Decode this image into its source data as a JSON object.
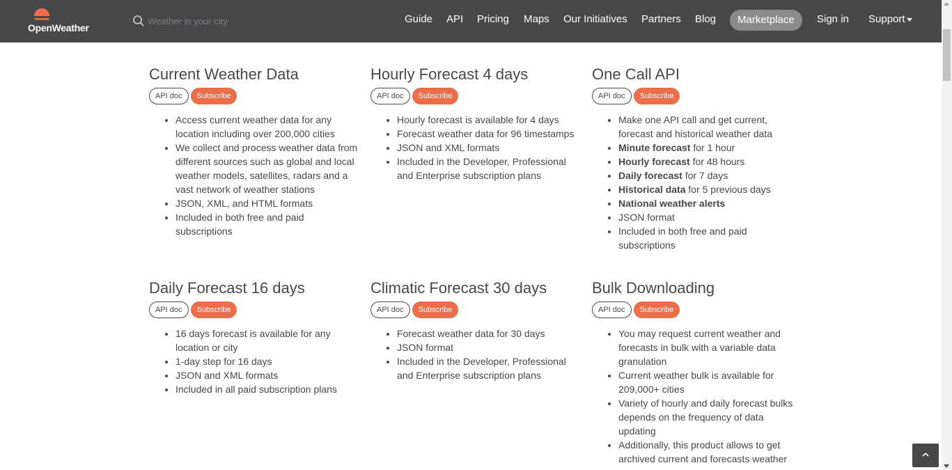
{
  "header": {
    "logo_text": "OpenWeather",
    "logo_icon": "sun-logo-icon",
    "search": {
      "placeholder": "Weather in your city",
      "icon": "search-icon"
    },
    "nav": [
      {
        "label": "Guide"
      },
      {
        "label": "API"
      },
      {
        "label": "Pricing"
      },
      {
        "label": "Maps"
      },
      {
        "label": "Our Initiatives"
      },
      {
        "label": "Partners"
      },
      {
        "label": "Blog"
      },
      {
        "label": "Marketplace",
        "highlighted": true
      },
      {
        "label": "Sign in"
      },
      {
        "label": "Support",
        "has_dropdown": true
      }
    ]
  },
  "colors": {
    "header_bg": "#48484a",
    "accent": "#eb6e4b",
    "pill_bg": "#8b8b8d",
    "text": "#48484a"
  },
  "products": [
    {
      "title": "Current Weather Data",
      "api_doc": "API doc",
      "subscribe": "Subscribe",
      "features": [
        {
          "text": "Access current weather data for any location including over 200,000 cities"
        },
        {
          "text": "We collect and process weather data from different sources such as global and local weather models, satellites, radars and a vast network of weather stations"
        },
        {
          "text": "JSON, XML, and HTML formats"
        },
        {
          "text": "Included in both free and paid subscriptions"
        }
      ]
    },
    {
      "title": "Hourly Forecast 4 days",
      "api_doc": "API doc",
      "subscribe": "Subscribe",
      "features": [
        {
          "text": "Hourly forecast is available for 4 days"
        },
        {
          "text": "Forecast weather data for 96 timestamps"
        },
        {
          "text": "JSON and XML formats"
        },
        {
          "text": "Included in the Developer, Professional and Enterprise subscription plans"
        }
      ]
    },
    {
      "title": "One Call API",
      "api_doc": "API doc",
      "subscribe": "Subscribe",
      "features": [
        {
          "text": "Make one API call and get current, forecast and historical weather data"
        },
        {
          "bold": "Minute forecast",
          "text": " for 1 hour"
        },
        {
          "bold": "Hourly forecast",
          "text": " for 48 hours"
        },
        {
          "bold": "Daily forecast",
          "text": " for 7 days"
        },
        {
          "bold": "Historical data",
          "text": " for 5 previous days"
        },
        {
          "bold": "National weather alerts",
          "text": ""
        },
        {
          "text": "JSON format"
        },
        {
          "text": "Included in both free and paid subscriptions"
        }
      ]
    },
    {
      "title": "Daily Forecast 16 days",
      "api_doc": "API doc",
      "subscribe": "Subscribe",
      "features": [
        {
          "text": "16 days forecast is available for any location or city"
        },
        {
          "text": "1-day step for 16 days"
        },
        {
          "text": "JSON and XML formats"
        },
        {
          "text": "Included in all paid subscription plans"
        }
      ]
    },
    {
      "title": "Climatic Forecast 30 days",
      "api_doc": "API doc",
      "subscribe": "Subscribe",
      "features": [
        {
          "text": "Forecast weather data for 30 days"
        },
        {
          "text": "JSON format"
        },
        {
          "text": "Included in the Developer, Professional and Enterprise subscription plans"
        }
      ]
    },
    {
      "title": "Bulk Downloading",
      "api_doc": "API doc",
      "subscribe": "Subscribe",
      "features": [
        {
          "text": "You may request current weather and forecasts in bulk with a variable data granulation"
        },
        {
          "text": "Current weather bulk is available for 209,000+ cities"
        },
        {
          "text": "Variety of hourly and daily forecast bulks depends on the frequency of data updating"
        },
        {
          "text": "Additionally, this product allows to get archived current and forecasts weather"
        }
      ]
    }
  ],
  "back_to_top_icon": "chevron-up-icon"
}
